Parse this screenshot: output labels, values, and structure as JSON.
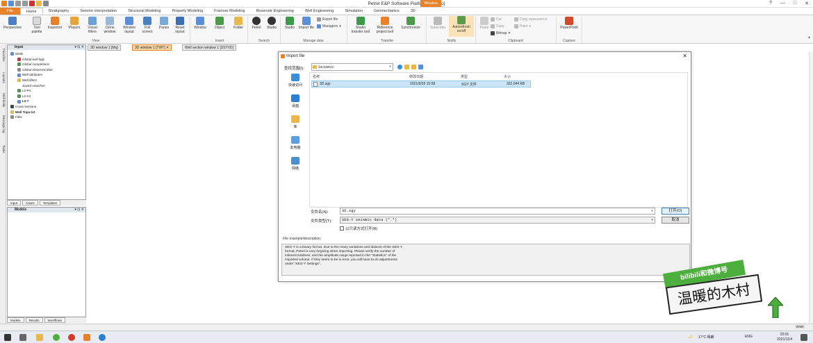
{
  "titlebar": {
    "title": "Petrel E&P Software Platform - [Video]",
    "window_tab": "Window",
    "controls": [
      "?",
      "—",
      "□",
      "✕"
    ]
  },
  "menu_tabs": [
    "File",
    "Home",
    "Stratigraphy",
    "Seismic interpretation",
    "Structural Modeling",
    "Property Modeling",
    "Fracture Modeling",
    "Reservoir Engineering",
    "Well Engineering",
    "Simulation",
    "Geomechanics",
    "3D"
  ],
  "ribbon": {
    "buttons": [
      {
        "label": "Perspective",
        "group": "View"
      },
      {
        "label": "Tool palette",
        "group": "View"
      },
      {
        "label": "Inspector",
        "group": "View"
      },
      {
        "label": "Players",
        "group": "View"
      },
      {
        "label": "Visual filters",
        "group": "View"
      },
      {
        "label": "Clone window",
        "group": "View"
      },
      {
        "label": "Window layout",
        "group": "View"
      },
      {
        "label": "Full screen",
        "group": "View"
      },
      {
        "label": "Panes",
        "group": "View"
      },
      {
        "label": "Reset layout",
        "group": "View"
      },
      {
        "label": "Window",
        "group": "Insert"
      },
      {
        "label": "Object",
        "group": "Insert"
      },
      {
        "label": "Folder",
        "group": "Insert"
      },
      {
        "label": "Petrel",
        "group": "Search"
      },
      {
        "label": "Studio",
        "group": "Search"
      },
      {
        "label": "Studio",
        "group": "Manage data"
      },
      {
        "label": "Import file",
        "group": "Manage data"
      },
      {
        "label": "Studio transfer tool",
        "group": "Transfer"
      },
      {
        "label": "Reference project tool",
        "group": "Transfer"
      },
      {
        "label": "Synchronize",
        "group": "Transfer"
      },
      {
        "label": "Subscribe",
        "group": "Notify"
      },
      {
        "label": "Autorefresh on/off",
        "group": "Notify"
      },
      {
        "label": "Paste",
        "group": "Clipboard"
      },
      {
        "label": "PowerPoint",
        "group": "Capture"
      }
    ],
    "small_items": {
      "export_file": "Export file",
      "managers": "Managers",
      "cut": "Cut",
      "copy": "Copy",
      "bitmap": "Bitmap",
      "copy_appearance": "Copy appearance",
      "paint": "Paint"
    },
    "groups": [
      "View",
      "Insert",
      "Search",
      "Manage data",
      "Transfer",
      "Notify",
      "Clipboard",
      "Capture"
    ]
  },
  "window_tabs": [
    "3D window 1 [Mq]",
    "3D window 1 [TWT]",
    "Well section window 1 [SSTVD]"
  ],
  "side_tabs": [
    "Favorites",
    "Layouts",
    "Well fields",
    "Message log",
    "Tasks"
  ],
  "input_panel": {
    "title": "Input",
    "tree": [
      {
        "label": "Wells",
        "indent": 1
      },
      {
        "label": "Global well logs",
        "indent": 2
      },
      {
        "label": "Global completions",
        "indent": 2
      },
      {
        "label": "Global observed data",
        "indent": 2
      },
      {
        "label": "Well attributes",
        "indent": 2
      },
      {
        "label": "Well filters",
        "indent": 2
      },
      {
        "label": "Saved searches",
        "indent": 2
      },
      {
        "label": "L2-P4",
        "indent": 2
      },
      {
        "label": "L2-X1",
        "indent": 2
      },
      {
        "label": "L2-7",
        "indent": 2
      },
      {
        "label": "Cross sections",
        "indent": 1
      },
      {
        "label": "Well Tops.txt",
        "indent": 1
      },
      {
        "label": "Files",
        "indent": 1
      }
    ],
    "tabs": [
      "Input",
      "Cases",
      "Templates"
    ]
  },
  "models_panel": {
    "title": "Models",
    "tabs": [
      "Models",
      "Results",
      "Workflows"
    ]
  },
  "dialog": {
    "title": "Import file",
    "look_in_label": "查找范围(I):",
    "look_in_value": "Seismic",
    "places": [
      "快速访问",
      "桌面",
      "库",
      "此电脑",
      "网络"
    ],
    "columns": [
      "名称",
      "修改日期",
      "类型",
      "大小"
    ],
    "files": [
      {
        "name": "3D.sgy",
        "date": "2021/6/26 15:58",
        "type": "SGY 文件",
        "size": "322,044 KB"
      }
    ],
    "file_name_label": "文件名(N):",
    "file_name_value": "3D.sgy",
    "file_type_label": "文件类型(T):",
    "file_type_value": "SEG-Y seismic data (*.*)",
    "readonly_label": "以只读方式打开(R)",
    "open_button": "打开(O)",
    "cancel_button": "取消",
    "desc_label": "File example/description:",
    "description": "SEG-Y is a binary format.  Due to the many variations and dialects of the SEG-Y format, Petrel is very forgiving when importing.  Please verify the number of inlines/crosslines, and the amplitude range reported in the \"Statistics\" of the imported volume.  If they seem to be in error, you will have to do adjustments under \"SEG-Y Settings\"."
  },
  "watermark": {
    "line1": "bilibili和微博号",
    "line2": "温暖的木村"
  },
  "statusbar": {
    "ram": "RAM"
  },
  "taskbar": {
    "weather": "17°C  晴朗",
    "lang": "ENG",
    "time": "20:01",
    "date": "2021/11/4"
  },
  "colors": {
    "accent_orange": "#e8822a",
    "selection_blue": "#cce4f7",
    "watermark_green": "#4caf3d"
  }
}
